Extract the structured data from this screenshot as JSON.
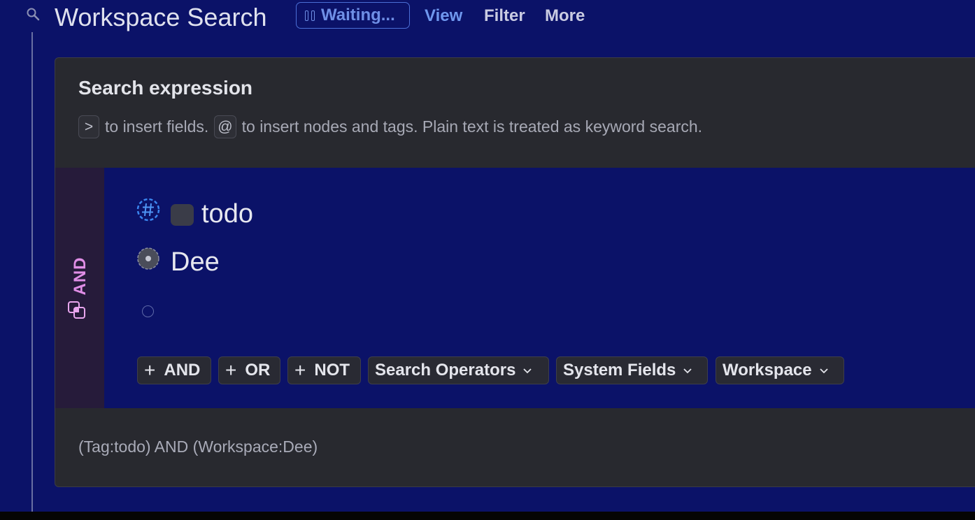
{
  "header": {
    "title": "Workspace Search",
    "status": "Waiting...",
    "menu": {
      "view": "View",
      "filter": "Filter",
      "more": "More"
    }
  },
  "search_expression": {
    "title": "Search expression",
    "hint": {
      "key_fields": ">",
      "text_fields": "to insert fields.",
      "key_nodes": "@",
      "text_nodes": "to insert nodes and tags. Plain text is treated as keyword search."
    },
    "group": {
      "operator": "AND",
      "rows": [
        {
          "type": "tag",
          "icon": "hash-tag-icon",
          "label": "todo"
        },
        {
          "type": "workspace",
          "icon": "workspace-icon",
          "label": "Dee"
        }
      ]
    },
    "operator_buttons": {
      "and": "AND",
      "or": "OR",
      "not": "NOT",
      "search_operators": "Search Operators",
      "system_fields": "System Fields",
      "workspace": "Workspace"
    },
    "query_preview": "(Tag:todo) AND (Workspace:Dee)"
  },
  "colors": {
    "background": "#0b1268",
    "card": "#28292f",
    "and_rail": "#261b3a",
    "and_label": "#e08ee6",
    "accent": "#6f97ee"
  }
}
